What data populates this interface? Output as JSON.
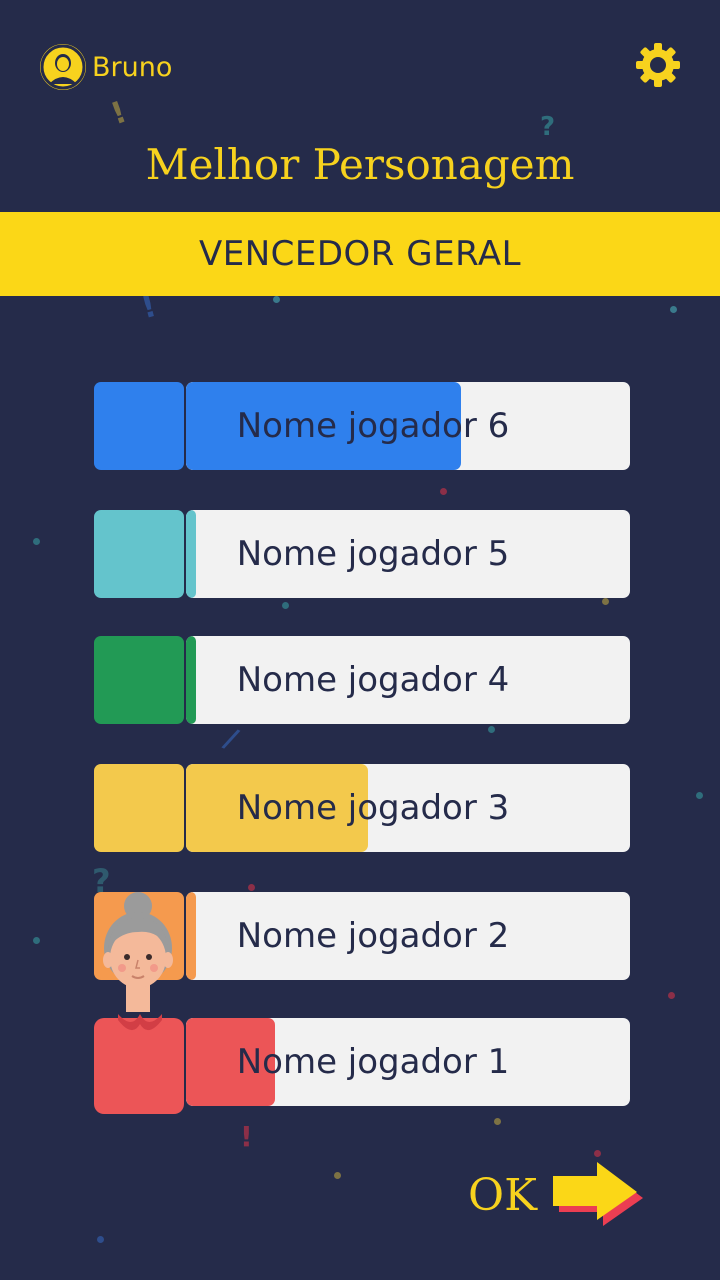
{
  "user": {
    "name": "Bruno"
  },
  "title": "Melhor Personagem",
  "banner": "VENCEDOR GERAL",
  "colors": {
    "background": "#252b4a",
    "accent": "#f7d21e",
    "banner": "#fbd717"
  },
  "players": [
    {
      "name": "Nome jogador 6",
      "color": "#2f80ed",
      "score": 0.62
    },
    {
      "name": "Nome jogador 5",
      "color": "#64c4cc",
      "score": 0.02
    },
    {
      "name": "Nome jogador 4",
      "color": "#229a55",
      "score": 0.02
    },
    {
      "name": "Nome jogador 3",
      "color": "#f3c94c",
      "score": 0.41
    },
    {
      "name": "Nome jogador 2",
      "color": "#f59a4e",
      "score": 0.02
    },
    {
      "name": "Nome jogador 1",
      "color": "#ec5557",
      "score": 0.2
    }
  ],
  "ok": {
    "label": "OK"
  },
  "icons": {
    "settings": "gear-icon",
    "user": "avatar-icon",
    "next": "arrow-right-icon"
  }
}
